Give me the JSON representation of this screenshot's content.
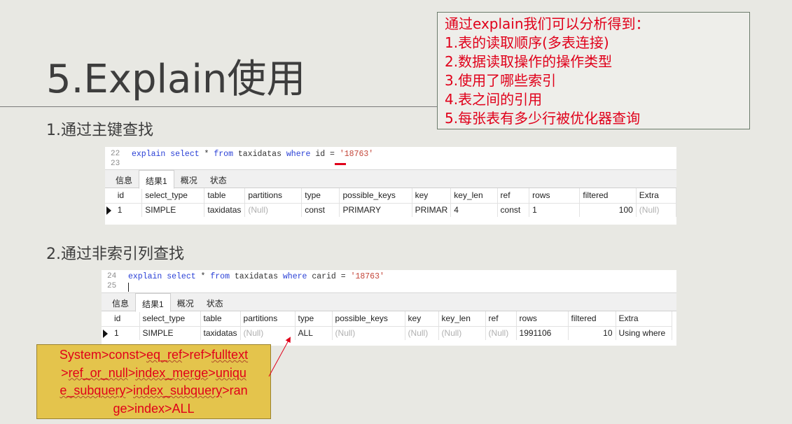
{
  "title": "5.Explain使用",
  "note_box": {
    "lines": [
      "通过explain我们可以分析得到：",
      "1.表的读取顺序(多表连接)",
      "2.数据读取操作的操作类型",
      "3.使用了哪些索引",
      "4.表之间的引用",
      "5.每张表有多少行被优化器查询"
    ]
  },
  "section1": {
    "heading": "1.通过主键查找",
    "editor": {
      "line_numbers": [
        "22",
        "23"
      ],
      "kw_explain": "explain",
      "kw_select": "select",
      "star": "*",
      "kw_from": "from",
      "table_name": "taxidatas",
      "kw_where": "where",
      "column": "id",
      "op": "=",
      "value": "'18763'"
    },
    "tabs": [
      "信息",
      "结果1",
      "概况",
      "状态"
    ],
    "active_tab": 1,
    "columns": [
      "id",
      "select_type",
      "table",
      "partitions",
      "type",
      "possible_keys",
      "key",
      "key_len",
      "ref",
      "rows",
      "filtered",
      "Extra"
    ],
    "row": [
      "1",
      "SIMPLE",
      "taxidatas",
      "(Null)",
      "const",
      "PRIMARY",
      "PRIMAR",
      "4",
      "const",
      "1",
      "100",
      "(Null)"
    ]
  },
  "section2": {
    "heading": "2.通过非索引列查找",
    "editor": {
      "line_numbers": [
        "24",
        "25"
      ],
      "kw_explain": "explain",
      "kw_select": "select",
      "star": "*",
      "kw_from": "from",
      "table_name": "taxidatas",
      "kw_where": "where",
      "column": "carid",
      "op": "=",
      "value": "'18763'"
    },
    "tabs": [
      "信息",
      "结果1",
      "概况",
      "状态"
    ],
    "active_tab": 1,
    "columns": [
      "id",
      "select_type",
      "table",
      "partitions",
      "type",
      "possible_keys",
      "key",
      "key_len",
      "ref",
      "rows",
      "filtered",
      "Extra"
    ],
    "row": [
      "1",
      "SIMPLE",
      "taxidatas",
      "(Null)",
      "ALL",
      "(Null)",
      "(Null)",
      "(Null)",
      "(Null)",
      "1991106",
      "10",
      "Using where"
    ]
  },
  "callout": {
    "lines": [
      [
        "System>const>",
        "eq_ref",
        ">ref>",
        "fulltext"
      ],
      [
        ">",
        "ref_or_null",
        ">",
        "index_merge",
        ">",
        "uniqu"
      ],
      [
        "e_subquery",
        ">",
        "index_subquery",
        ">ran"
      ],
      [
        "ge>index>ALL"
      ]
    ]
  },
  "colors": {
    "accent_red": "#e0001a",
    "callout_bg": "#e4c44c",
    "keyword_blue": "#2a40d6"
  }
}
